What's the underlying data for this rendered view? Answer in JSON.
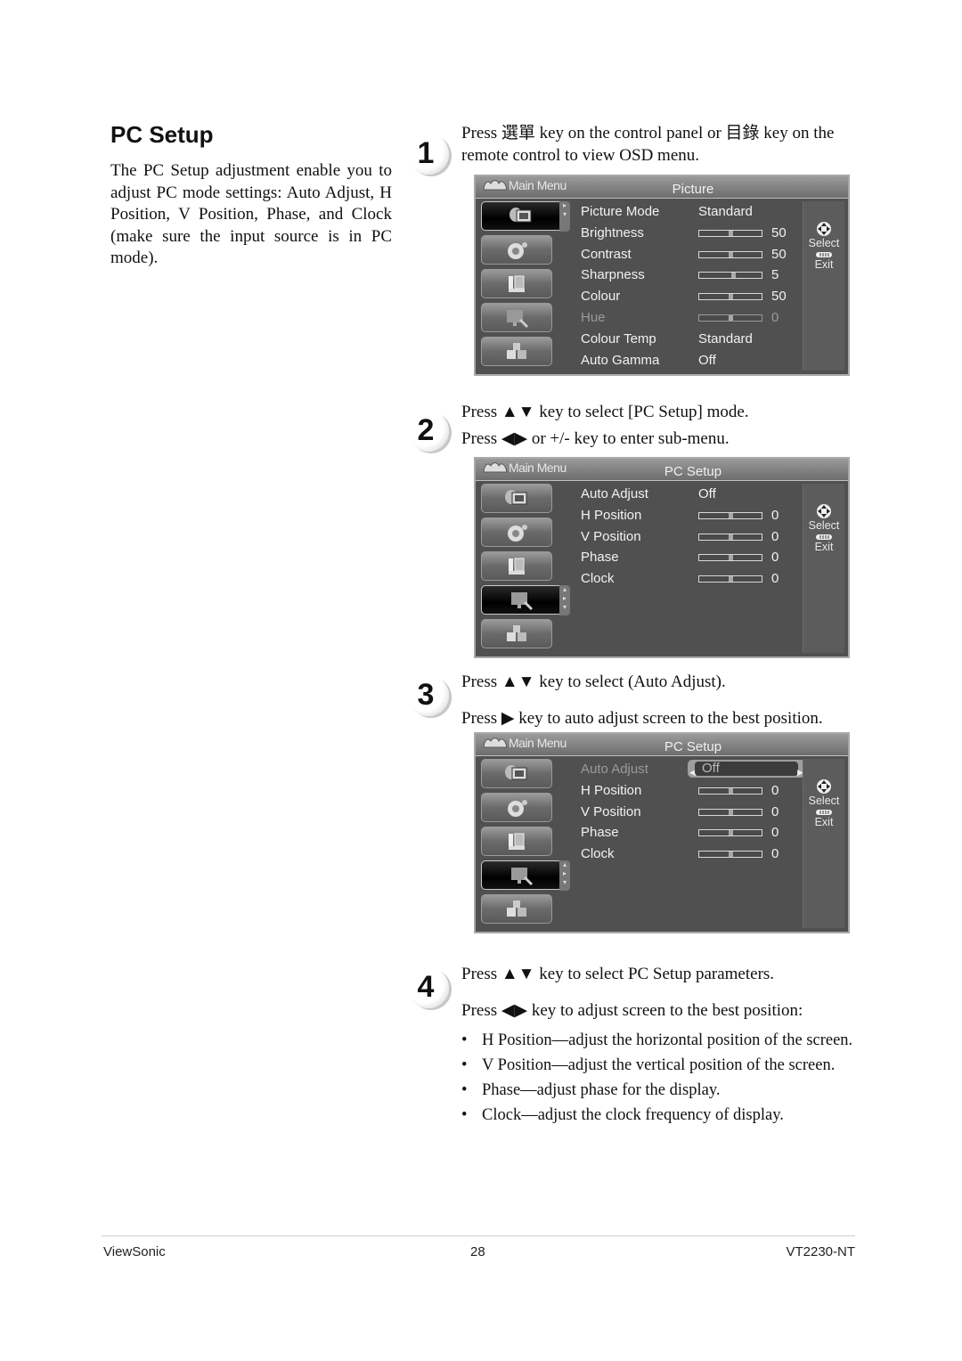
{
  "section": {
    "title": "PC Setup",
    "intro": "The PC Setup adjustment enable you to adjust PC mode settings: Auto Adjust, H Position, V Position, Phase, and Clock (make sure the input source is in PC mode)."
  },
  "steps": [
    {
      "number": "1",
      "lines": [
        "Press 選單 key on the control panel or 目錄 key on the remote control to view OSD menu."
      ]
    },
    {
      "number": "2",
      "lines": [
        "Press ▲▼ key to select [PC Setup] mode.",
        "Press ◀▶ or +/- key to enter sub-menu."
      ]
    },
    {
      "number": "3",
      "lines": [
        "Press ▲▼ key to select (Auto Adjust).",
        "Press ▶ key to auto adjust screen to the best position."
      ]
    },
    {
      "number": "4",
      "lines": [
        "Press ▲▼ key to select PC Setup parameters.",
        "Press ◀▶ key to adjust screen to the best position:"
      ]
    }
  ],
  "osd_common": {
    "main_menu_label": "Main Menu",
    "select_label": "Select",
    "exit_label": "Exit",
    "sidebar_icons": [
      "picture-icon",
      "audio-icon",
      "display-icon",
      "pc-setup-icon",
      "setup-icon"
    ]
  },
  "osd1": {
    "title": "Picture",
    "active_tab": 0,
    "rows": [
      {
        "label": "Picture Mode",
        "value": "Standard"
      },
      {
        "label": "Brightness",
        "slider": 0.5,
        "number": "50"
      },
      {
        "label": "Contrast",
        "slider": 0.5,
        "number": "50"
      },
      {
        "label": "Sharpness",
        "slider": 0.55,
        "number": "5"
      },
      {
        "label": "Colour",
        "slider": 0.5,
        "number": "50"
      },
      {
        "label": "Hue",
        "slider": 0.5,
        "number": "0",
        "disabled": true
      },
      {
        "label": "Colour Temp",
        "value": "Standard"
      },
      {
        "label": "Auto Gamma",
        "value": "Off"
      }
    ]
  },
  "osd2": {
    "title": "PC Setup",
    "active_tab": 3,
    "rows": [
      {
        "label": "Auto Adjust",
        "value": "Off"
      },
      {
        "label": "H Position",
        "slider": 0.5,
        "number": "0"
      },
      {
        "label": "V Position",
        "slider": 0.5,
        "number": "0"
      },
      {
        "label": "Phase",
        "slider": 0.5,
        "number": "0"
      },
      {
        "label": "Clock",
        "slider": 0.5,
        "number": "0"
      }
    ]
  },
  "osd3": {
    "title": "PC Setup",
    "active_tab": 3,
    "rows": [
      {
        "label": "Auto Adjust",
        "value": "Off",
        "selected": true
      },
      {
        "label": "H Position",
        "slider": 0.5,
        "number": "0"
      },
      {
        "label": "V Position",
        "slider": 0.5,
        "number": "0"
      },
      {
        "label": "Phase",
        "slider": 0.5,
        "number": "0"
      },
      {
        "label": "Clock",
        "slider": 0.5,
        "number": "0"
      }
    ]
  },
  "bullets": [
    "H Position—adjust the horizontal position of the screen.",
    "V Position—adjust the vertical position of the screen.",
    "Phase—adjust phase for the display.",
    "Clock—adjust the clock frequency of display."
  ],
  "footer": {
    "brand": "ViewSonic",
    "page_number": "28",
    "model": "VT2230-NT"
  }
}
